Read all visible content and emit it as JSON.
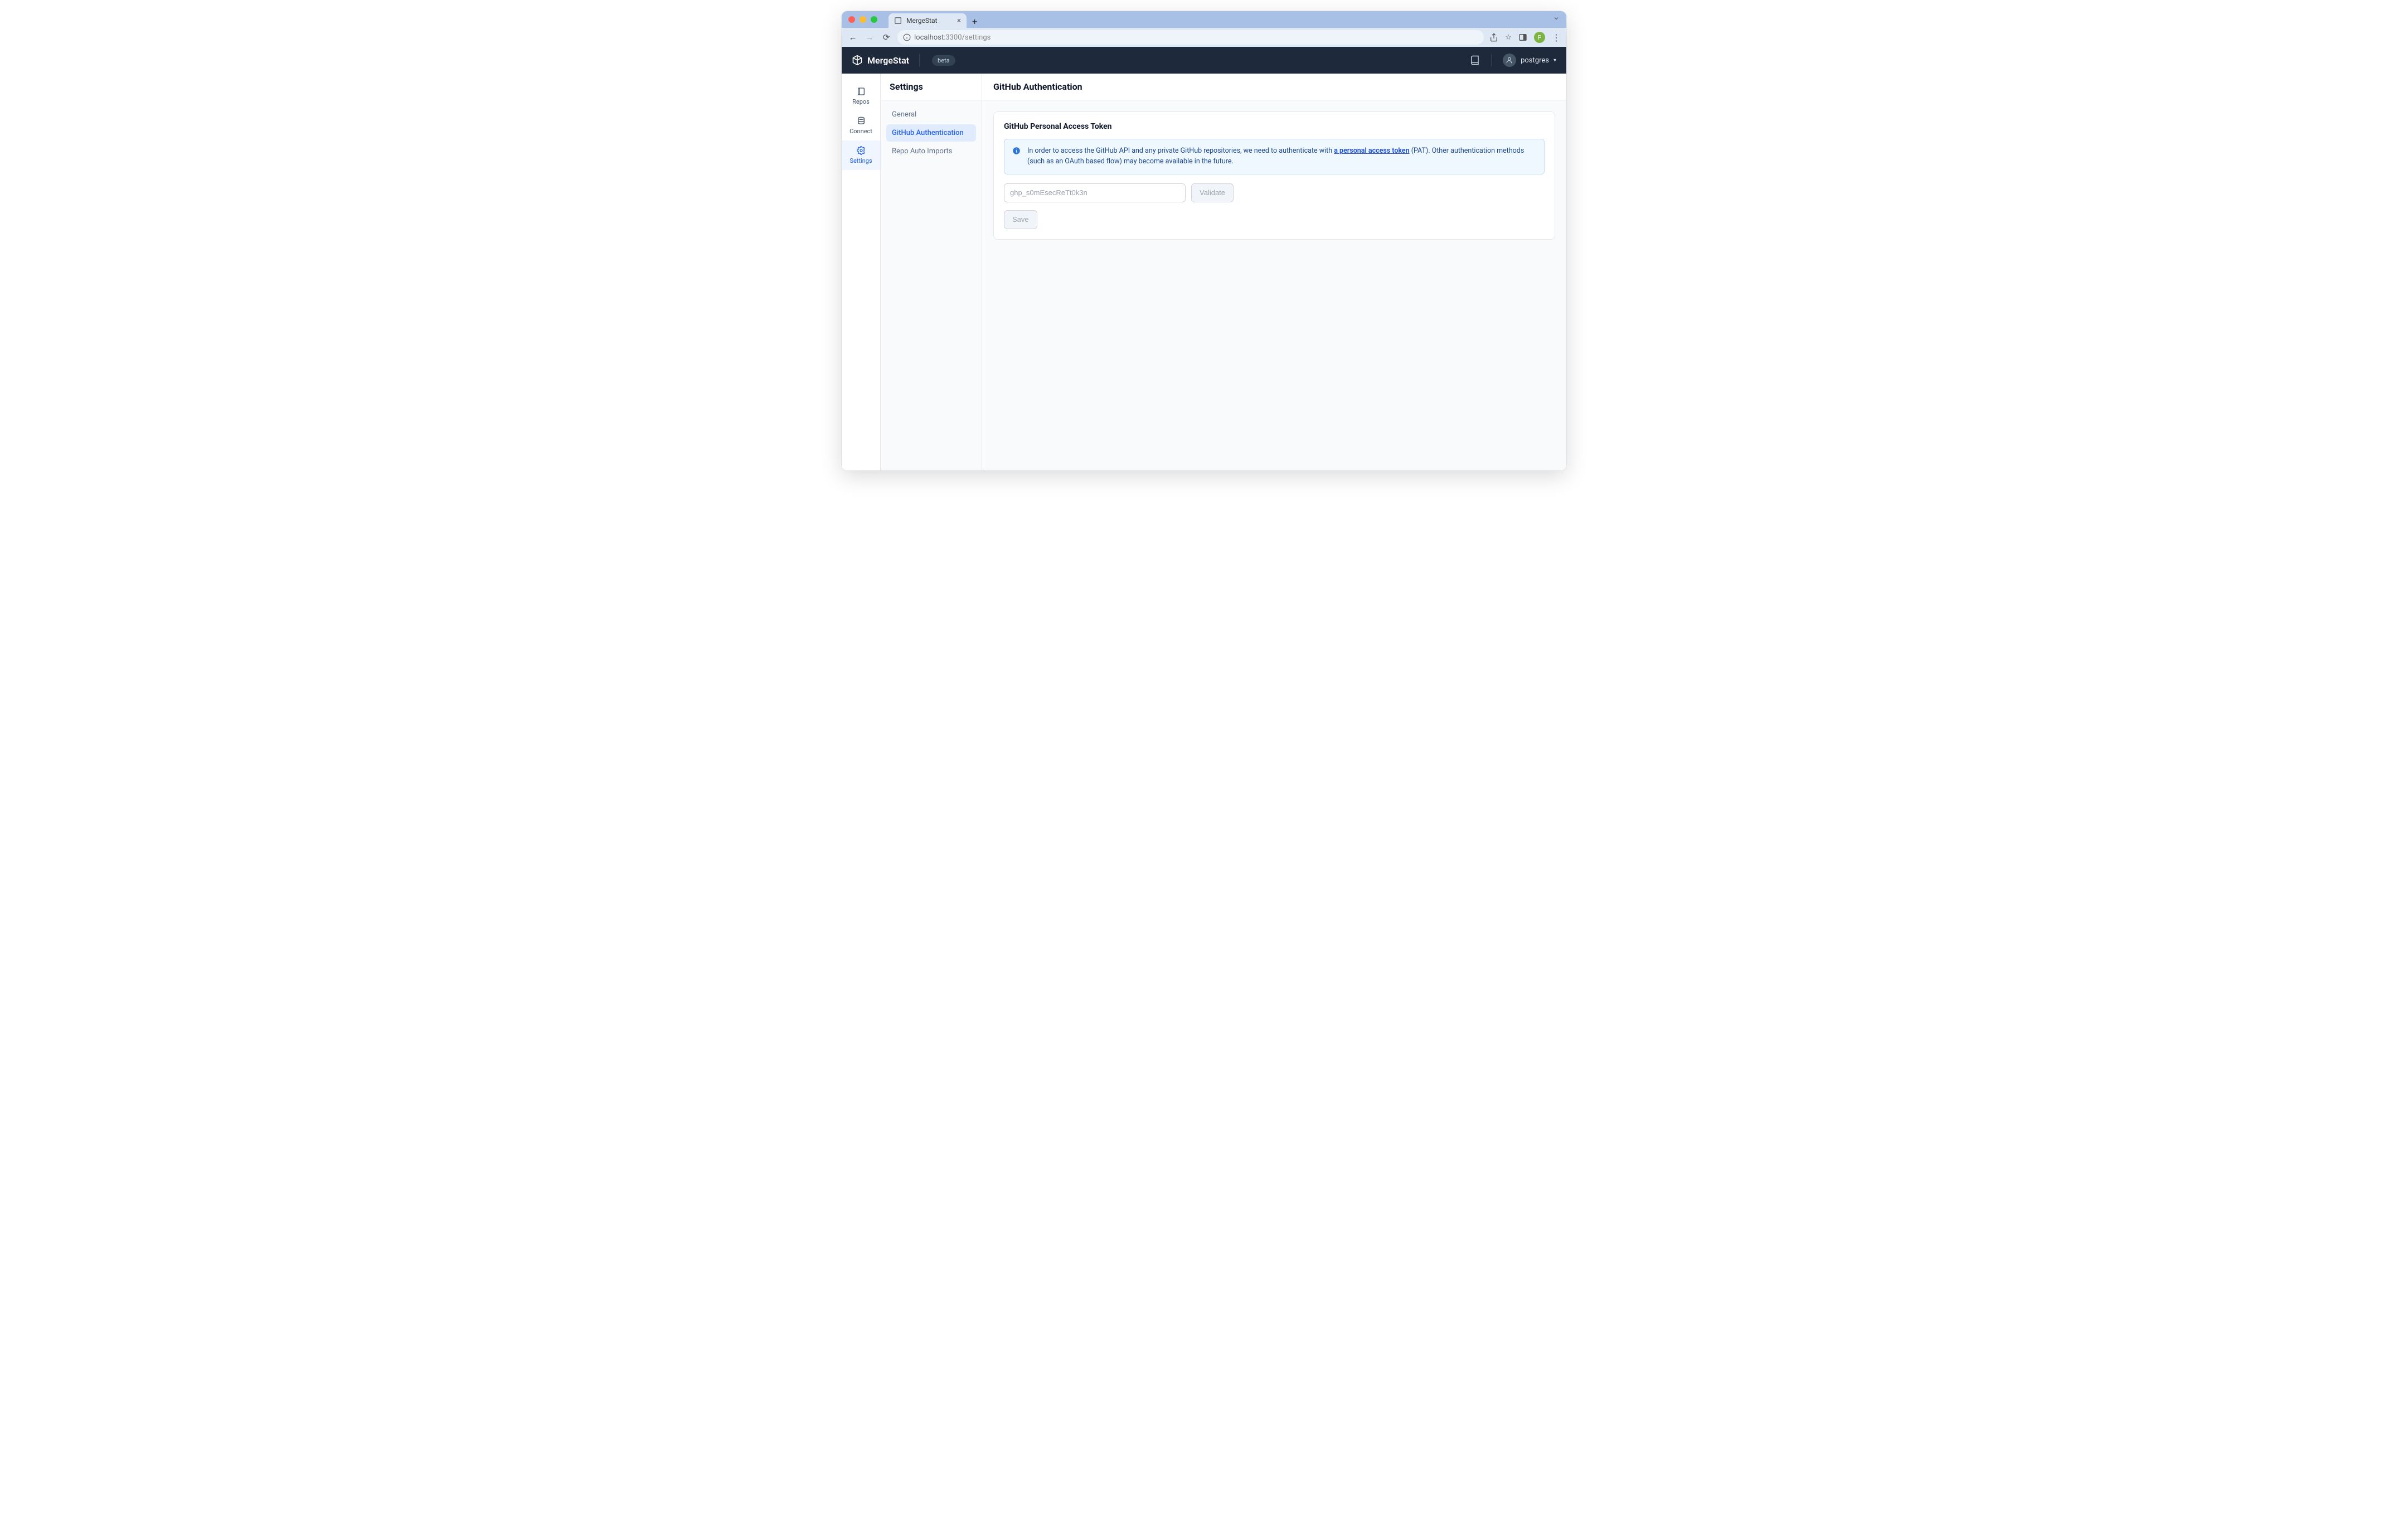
{
  "browser": {
    "tab_title": "MergeStat",
    "url_host": "localhost",
    "url_port_path": ":3300/settings",
    "profile_initial": "P"
  },
  "header": {
    "brand": "MergeStat",
    "beta_label": "beta",
    "username": "postgres"
  },
  "rail": {
    "items": [
      {
        "label": "Repos"
      },
      {
        "label": "Connect"
      },
      {
        "label": "Settings"
      }
    ]
  },
  "settings": {
    "title": "Settings",
    "nav": [
      {
        "label": "General"
      },
      {
        "label": "GitHub Authentication"
      },
      {
        "label": "Repo Auto Imports"
      }
    ]
  },
  "main": {
    "title": "GitHub Authentication",
    "card_title": "GitHub Personal Access Token",
    "info_text_pre": "In order to access the GitHub API and any private GitHub repositories, we need to authenticate with ",
    "info_link_text": "a personal access token",
    "info_text_post": " (PAT). Other authentication methods (such as an OAuth based flow) may become available in the future.",
    "input_placeholder": "ghp_s0mEsecReTt0k3n",
    "validate_label": "Validate",
    "save_label": "Save"
  }
}
